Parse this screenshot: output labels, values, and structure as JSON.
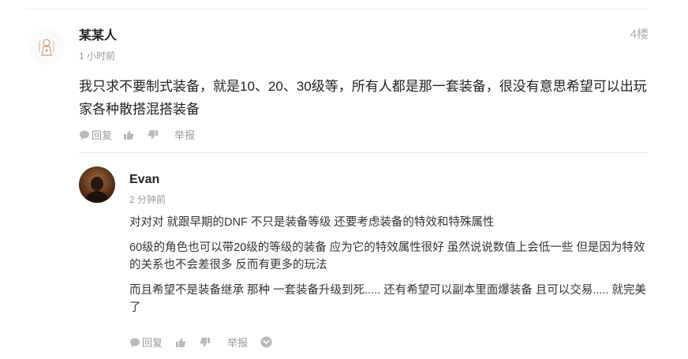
{
  "main_comment": {
    "author": "某某人",
    "time": "1 小时前",
    "floor": "4楼",
    "content": "我只求不要制式装备，就是10、20、30级等，所有人都是那一套装备，很没有意思希望可以出玩家各种散搭混搭装备",
    "actions": {
      "reply_label": "回复",
      "report_label": "举报"
    }
  },
  "reply": {
    "author": "Evan",
    "time": "2 分钟前",
    "paragraphs": [
      "对对对 就跟早期的DNF 不只是装备等级 还要考虑装备的特效和特殊属性",
      "60级的角色也可以带20级的等级的装备 应为它的特效属性很好 虽然说说数值上会低一些 但是因为特效的关系也不会差很多 反而有更多的玩法",
      "而且希望不是装备继承 那种 一套装备升级到死..... 还有希望可以副本里面爆装备 且可以交易..... 就完美了"
    ],
    "actions": {
      "reply_label": "回复",
      "report_label": "举报"
    }
  },
  "colors": {
    "text": "#222222",
    "muted": "#999999",
    "divider": "#ececec"
  }
}
